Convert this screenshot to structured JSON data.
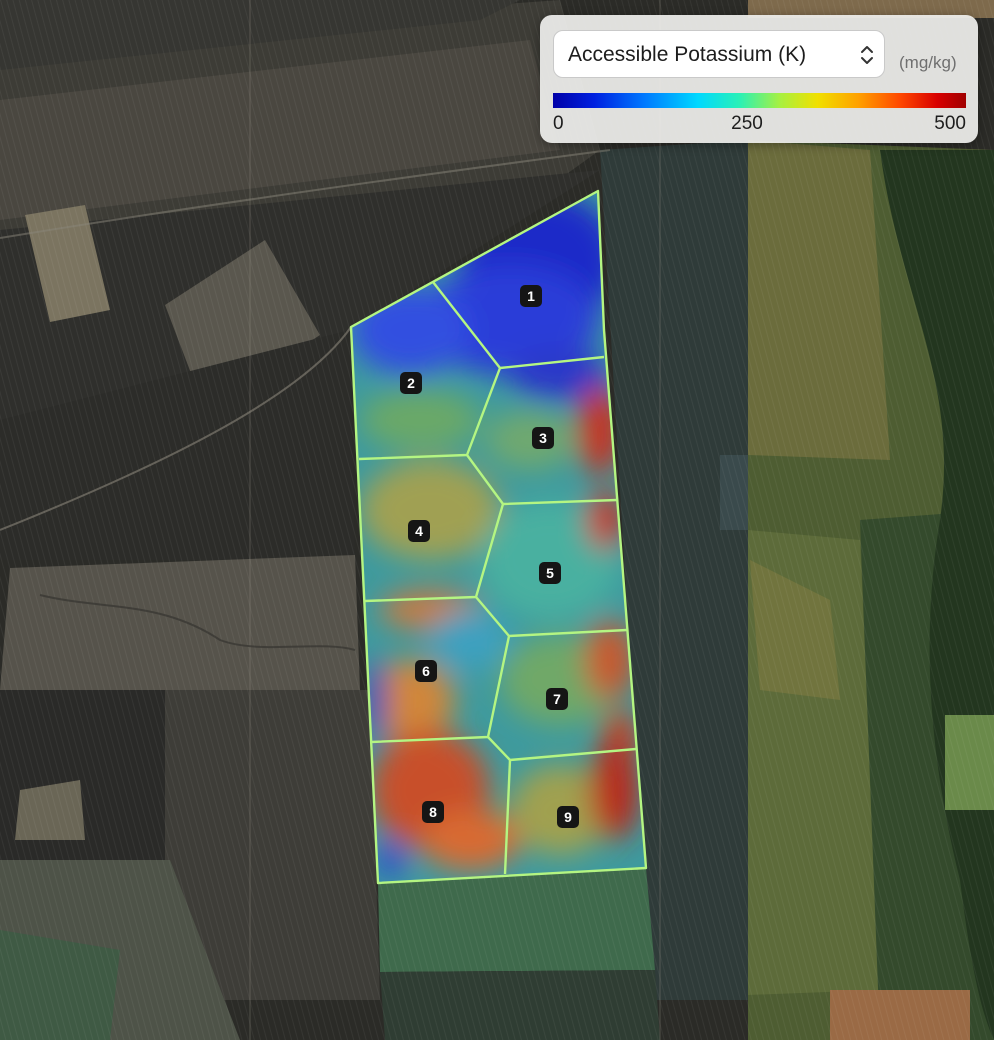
{
  "layer_selector": {
    "selected": "Accessible Potassium (K)",
    "unit": "(mg/kg)"
  },
  "legend": {
    "min": "0",
    "mid": "250",
    "max": "500",
    "color_stops": [
      "#0000a8",
      "#0078ff",
      "#00d8ff",
      "#a8f040",
      "#f0e000",
      "#ff4800",
      "#a00000"
    ]
  },
  "zones": [
    {
      "id": "1",
      "level": "low"
    },
    {
      "id": "2",
      "level": "low-medium"
    },
    {
      "id": "3",
      "level": "medium"
    },
    {
      "id": "4",
      "level": "medium"
    },
    {
      "id": "5",
      "level": "medium"
    },
    {
      "id": "6",
      "level": "medium-high"
    },
    {
      "id": "7",
      "level": "medium-high"
    },
    {
      "id": "8",
      "level": "high"
    },
    {
      "id": "9",
      "level": "high"
    }
  ],
  "colors": {
    "zone_outline": "#b4f582",
    "zone_label_bg": "#151515"
  }
}
